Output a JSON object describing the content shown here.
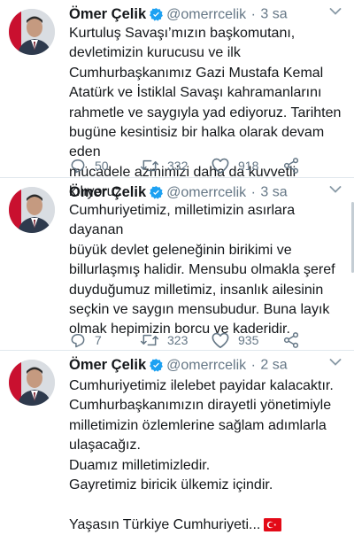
{
  "colors": {
    "verified": "#1da1f2",
    "muted": "#657786",
    "text": "#14171a",
    "divider": "#e1e8ed"
  },
  "icons": [
    "verified-badge-icon",
    "chevron-down-icon",
    "reply-icon",
    "retweet-icon",
    "like-icon",
    "share-icon",
    "turkey-flag-icon"
  ],
  "tweets": [
    {
      "name": "Ömer Çelik",
      "handle": "@omerrcelik",
      "separator": "·",
      "time": "3 sa",
      "text": "Kurtuluş Savaşı’mızın başkomutanı,\ndevletimizin kurucusu ve ilk\nCumhurbaşkanımız Gazi Mustafa Kemal\nAtatürk ve İstiklal Savaşı kahramanlarını\nrahmetle ve saygıyla  yad ediyoruz. Tarihten\nbugüne kesintisiz bir halka olarak devam eden\nmücadele azmimizi daha da kuvvetli kılıyoruz.",
      "replies": "50",
      "retweets": "332",
      "likes": "918"
    },
    {
      "name": "Ömer Çelik",
      "handle": "@omerrcelik",
      "separator": "·",
      "time": "3 sa",
      "text": "Cumhuriyetimiz, milletimizin asırlara dayanan\nbüyük devlet geleneğinin birikimi ve\nbillurlaşmış halidir. Mensubu olmakla şeref\nduyduğumuz milletimiz, insanlık ailesinin\nseçkin ve saygın mensubudur. Buna layık\nolmak hepimizin borcu ve kaderidir.",
      "replies": "7",
      "retweets": "323",
      "likes": "935"
    },
    {
      "name": "Ömer Çelik",
      "handle": "@omerrcelik",
      "separator": "·",
      "time": "2 sa",
      "text": "Cumhuriyetimiz ilelebet payidar kalacaktır.\nCumhurbaşkanımızın dirayetli yönetimiyle\nmilletimizin özlemlerine sağlam adımlarla\nulaşacağız.\nDuamız milletimizledir.\nGayretimiz biricik ülkemiz içindir.\n\nYaşasın Türkiye Cumhuriyeti..."
    }
  ]
}
